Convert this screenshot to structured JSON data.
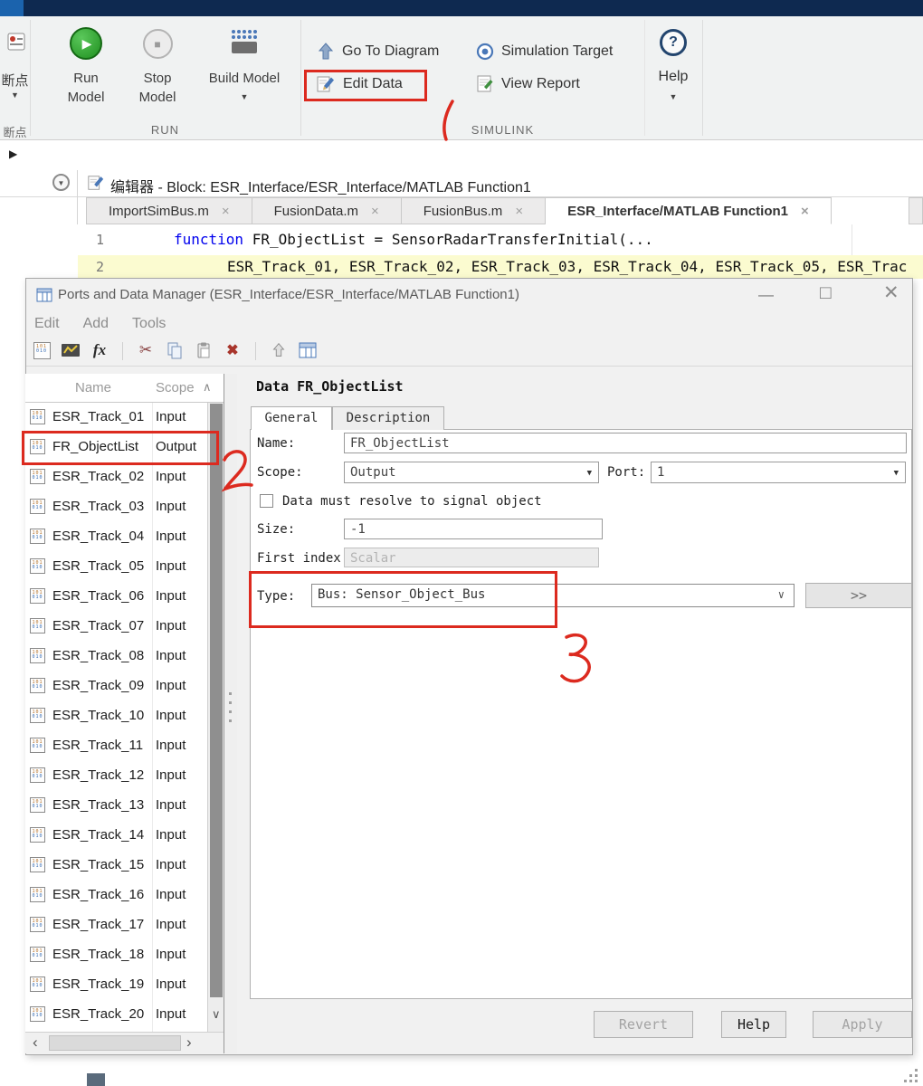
{
  "ribbon": {
    "breakpoint_label": "断点",
    "breakpoint_section": "断点",
    "run_label1": "Run",
    "run_label2": "Model",
    "stop_label1": "Stop",
    "stop_label2": "Model",
    "build_label": "Build Model",
    "goto_diagram_label": "Go To Diagram",
    "edit_data_label": "Edit Data",
    "sim_target_label": "Simulation Target",
    "view_report_label": "View Report",
    "help_label": "Help",
    "section_run": "RUN",
    "section_simulink": "SIMULINK",
    "caret_glyph": "▼",
    "run_glyph": "▶",
    "stop_glyph": "■",
    "help_glyph": "?"
  },
  "editor": {
    "expander_glyph": "▶",
    "header_title": "编辑器 - Block: ESR_Interface/ESR_Interface/MATLAB Function1",
    "tab_close_glyph": "×",
    "tabs": [
      {
        "label": "ImportSimBus.m",
        "active": false
      },
      {
        "label": "FusionData.m",
        "active": false
      },
      {
        "label": "FusionBus.m",
        "active": false
      },
      {
        "label": "ESR_Interface/MATLAB Function1",
        "active": true
      }
    ],
    "code": {
      "line1_number": "1",
      "line1_keyword": "function",
      "line1_rest": " FR_ObjectList = SensorRadarTransferInitial(...",
      "line2_number": "2",
      "line2_text": "ESR_Track_01, ESR_Track_02, ESR_Track_03, ESR_Track_04, ESR_Track_05, ESR_Trac"
    }
  },
  "dialog": {
    "title": "Ports and Data Manager (ESR_Interface/ESR_Interface/MATLAB Function1)",
    "controls": {
      "minimize": "—",
      "maximize": "□",
      "close": "✕"
    },
    "menus": [
      "Edit",
      "Add",
      "Tools"
    ],
    "toolbar": {
      "fx_label": "fx",
      "cut_glyph": "✂",
      "delete_glyph": "✖"
    },
    "list": {
      "col_name": "Name",
      "col_scope": "Scope",
      "sort_glyph": "∧",
      "scroll_down_glyph": "∨",
      "scroll_left_glyph": "‹",
      "scroll_right_glyph": "›",
      "rows": [
        {
          "name": "ESR_Track_01",
          "scope": "Input",
          "highlighted": false
        },
        {
          "name": "FR_ObjectList",
          "scope": "Output",
          "highlighted": true
        },
        {
          "name": "ESR_Track_02",
          "scope": "Input",
          "highlighted": false
        },
        {
          "name": "ESR_Track_03",
          "scope": "Input",
          "highlighted": false
        },
        {
          "name": "ESR_Track_04",
          "scope": "Input",
          "highlighted": false
        },
        {
          "name": "ESR_Track_05",
          "scope": "Input",
          "highlighted": false
        },
        {
          "name": "ESR_Track_06",
          "scope": "Input",
          "highlighted": false
        },
        {
          "name": "ESR_Track_07",
          "scope": "Input",
          "highlighted": false
        },
        {
          "name": "ESR_Track_08",
          "scope": "Input",
          "highlighted": false
        },
        {
          "name": "ESR_Track_09",
          "scope": "Input",
          "highlighted": false
        },
        {
          "name": "ESR_Track_10",
          "scope": "Input",
          "highlighted": false
        },
        {
          "name": "ESR_Track_11",
          "scope": "Input",
          "highlighted": false
        },
        {
          "name": "ESR_Track_12",
          "scope": "Input",
          "highlighted": false
        },
        {
          "name": "ESR_Track_13",
          "scope": "Input",
          "highlighted": false
        },
        {
          "name": "ESR_Track_14",
          "scope": "Input",
          "highlighted": false
        },
        {
          "name": "ESR_Track_15",
          "scope": "Input",
          "highlighted": false
        },
        {
          "name": "ESR_Track_16",
          "scope": "Input",
          "highlighted": false
        },
        {
          "name": "ESR_Track_17",
          "scope": "Input",
          "highlighted": false
        },
        {
          "name": "ESR_Track_18",
          "scope": "Input",
          "highlighted": false
        },
        {
          "name": "ESR_Track_19",
          "scope": "Input",
          "highlighted": false
        },
        {
          "name": "ESR_Track_20",
          "scope": "Input",
          "highlighted": false
        }
      ]
    },
    "detail": {
      "heading": "Data FR_ObjectList",
      "tab_general": "General",
      "tab_description": "Description",
      "name_label": "Name:",
      "name_value": "FR_ObjectList",
      "scope_label": "Scope:",
      "scope_value": "Output",
      "port_label": "Port:",
      "port_value": "1",
      "resolve_label": "Data must resolve to signal object",
      "size_label": "Size:",
      "size_value": "-1",
      "first_index_label": "First index",
      "first_index_value": "Scalar",
      "type_label": "Type:",
      "type_value": "Bus: Sensor_Object_Bus",
      "expand_label": ">>",
      "dropdown_glyph": "▼",
      "combo_glyph": "∨"
    },
    "buttons": {
      "revert": "Revert",
      "help": "Help",
      "apply": "Apply"
    }
  },
  "annotations": {
    "step1": "1",
    "step2": "2",
    "step3": "3",
    "color": "#dc2a1f"
  }
}
